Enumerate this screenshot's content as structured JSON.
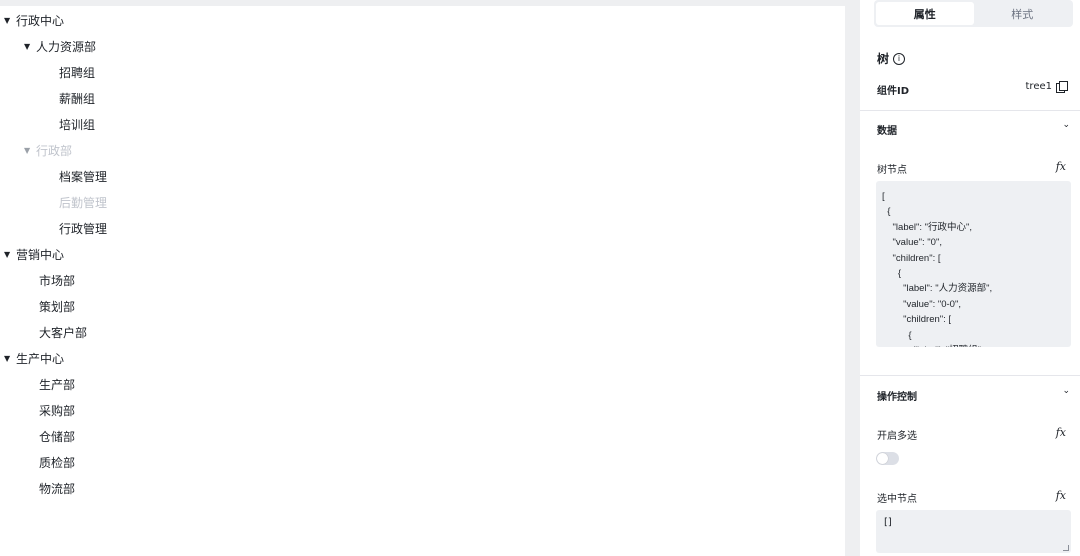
{
  "tree": {
    "nodes": [
      {
        "label": "行政中心",
        "level": 0,
        "expanded": true,
        "disabled": false
      },
      {
        "label": "人力资源部",
        "level": 1,
        "expanded": true,
        "disabled": false
      },
      {
        "label": "招聘组",
        "level": 2,
        "disabled": false
      },
      {
        "label": "薪酬组",
        "level": 2,
        "disabled": false
      },
      {
        "label": "培训组",
        "level": 2,
        "disabled": false
      },
      {
        "label": "行政部",
        "level": 1,
        "expanded": true,
        "disabled": true
      },
      {
        "label": "档案管理",
        "level": 2,
        "disabled": false
      },
      {
        "label": "后勤管理",
        "level": 2,
        "disabled": true
      },
      {
        "label": "行政管理",
        "level": 2,
        "disabled": false
      },
      {
        "label": "营销中心",
        "level": 0,
        "expanded": true,
        "disabled": false
      },
      {
        "label": "市场部",
        "level": 1,
        "disabled": false
      },
      {
        "label": "策划部",
        "level": 1,
        "disabled": false
      },
      {
        "label": "大客户部",
        "level": 1,
        "disabled": false
      },
      {
        "label": "生产中心",
        "level": 0,
        "expanded": true,
        "disabled": false
      },
      {
        "label": "生产部",
        "level": 1,
        "disabled": false
      },
      {
        "label": "采购部",
        "level": 1,
        "disabled": false
      },
      {
        "label": "仓储部",
        "level": 1,
        "disabled": false
      },
      {
        "label": "质检部",
        "level": 1,
        "disabled": false
      },
      {
        "label": "物流部",
        "level": 1,
        "disabled": false
      }
    ],
    "expand_glyph": "▼"
  },
  "panel": {
    "tabs": [
      {
        "label": "属性",
        "active": true
      },
      {
        "label": "样式",
        "active": false
      }
    ],
    "component_title": "树",
    "info_glyph": "i",
    "component_id_label": "组件ID",
    "component_id_value": "tree1",
    "data_section_label": "数据",
    "tree_nodes_label": "树节点",
    "fx_label": "fx",
    "chevron_glyph": "⌄",
    "tree_nodes_code": "[\n  {\n    \"label\": \"行政中心\",\n    \"value\": \"0\",\n    \"children\": [\n      {\n        \"label\": \"人力资源部\",\n        \"value\": \"0-0\",\n        \"children\": [\n          {\n            \"label\": \"招聘组\",",
    "operation_section_label": "操作控制",
    "multi_select_label": "开启多选",
    "multi_select_enabled": false,
    "selected_nodes_label": "选中节点",
    "selected_nodes_value": "[]"
  },
  "colors": {
    "canvas_bg": "#eeeff1",
    "disabled_text": "#c0c4cc",
    "input_bg": "#eef0f3"
  }
}
